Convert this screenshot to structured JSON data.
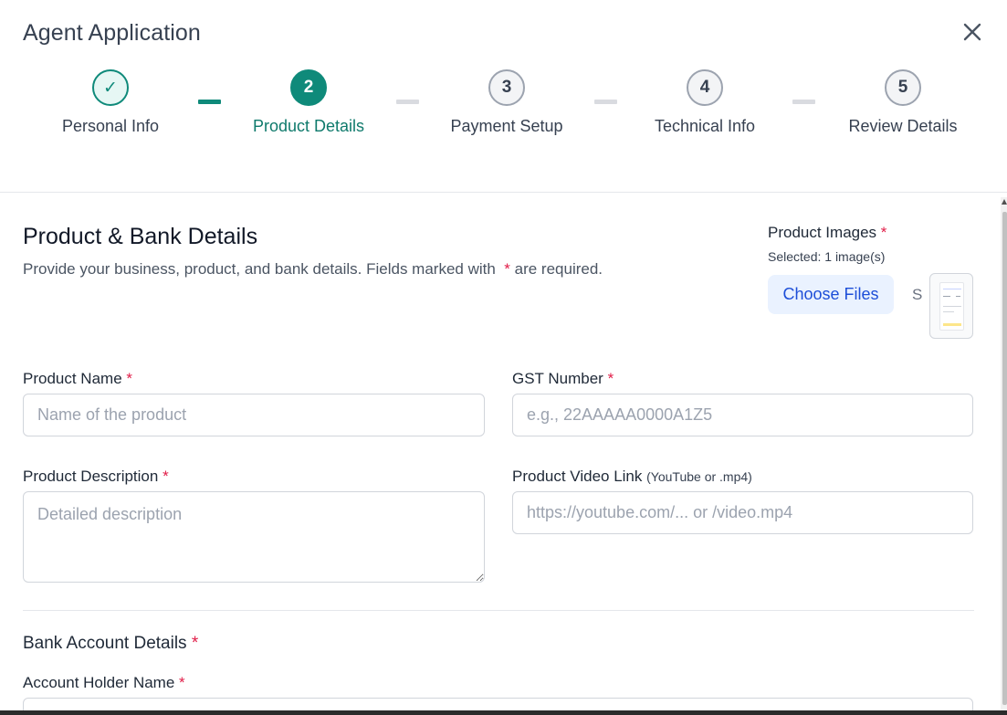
{
  "header": {
    "title": "Agent Application"
  },
  "stepper": {
    "steps": [
      {
        "number": "✓",
        "label": "Personal Info",
        "state": "done"
      },
      {
        "number": "2",
        "label": "Product Details",
        "state": "active"
      },
      {
        "number": "3",
        "label": "Payment Setup",
        "state": "todo"
      },
      {
        "number": "4",
        "label": "Technical Info",
        "state": "todo"
      },
      {
        "number": "5",
        "label": "Review Details",
        "state": "todo"
      }
    ]
  },
  "section": {
    "title": "Product & Bank Details",
    "description_pre": "Provide your business, product, and bank details. Fields marked with",
    "required_mark": "*",
    "description_post": "are required."
  },
  "product_images": {
    "label": "Product Images",
    "required_mark": "*",
    "selected_text": "Selected: 1 image(s)",
    "choose_label": "Choose Files",
    "file_status": "S"
  },
  "fields": {
    "product_name": {
      "label": "Product Name",
      "required_mark": "*",
      "placeholder": "Name of the product",
      "value": ""
    },
    "gst_number": {
      "label": "GST Number",
      "required_mark": "*",
      "placeholder": "e.g., 22AAAAA0000A1Z5",
      "value": ""
    },
    "product_description": {
      "label": "Product Description",
      "required_mark": "*",
      "placeholder": "Detailed description",
      "value": ""
    },
    "product_video": {
      "label": "Product Video Link",
      "hint": "(YouTube or .mp4)",
      "placeholder": "https://youtube.com/... or /video.mp4",
      "value": ""
    }
  },
  "bank": {
    "title": "Bank Account Details",
    "required_mark": "*",
    "account_holder": {
      "label": "Account Holder Name",
      "required_mark": "*"
    }
  },
  "colors": {
    "accent": "#0f8a7a",
    "required": "#e11d48",
    "link_blue": "#1d4ed8"
  }
}
